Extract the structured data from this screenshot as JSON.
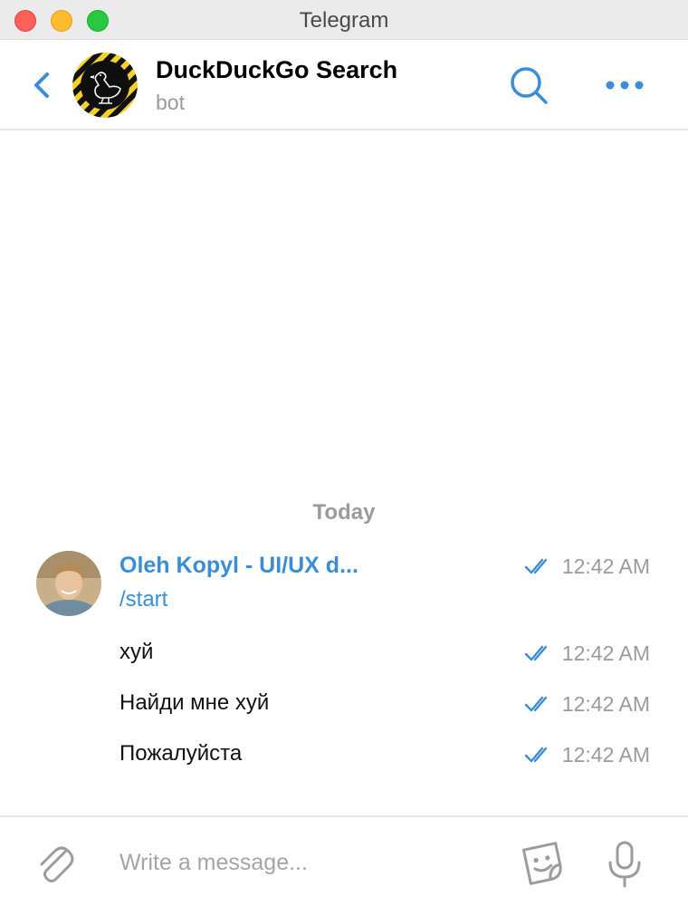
{
  "window": {
    "title": "Telegram"
  },
  "header": {
    "chat_title": "DuckDuckGo Search",
    "chat_subtitle": "bot",
    "icons": {
      "back": "chevron-left-icon",
      "avatar": "duck-icon",
      "search": "search-icon",
      "more": "more-dots-icon"
    }
  },
  "chat": {
    "date_separator": "Today",
    "sender_name": "Oleh Kopyl - UI/UX d...",
    "messages": [
      {
        "text": "/start",
        "time": "12:42 AM",
        "status": "read",
        "is_command": true
      },
      {
        "text": "хуй",
        "time": "12:42 AM",
        "status": "read"
      },
      {
        "text": "Найди мне хуй",
        "time": "12:42 AM",
        "status": "read"
      },
      {
        "text": "Пожалуйста",
        "time": "12:42 AM",
        "status": "read"
      }
    ]
  },
  "composer": {
    "placeholder": "Write a message...",
    "value": "",
    "icons": {
      "attach": "paperclip-icon",
      "sticker": "sticker-icon",
      "mic": "microphone-icon"
    }
  },
  "colors": {
    "accent": "#3a8dd6",
    "meta_text": "#9b9b9b",
    "title_bar": "#ebebeb"
  }
}
